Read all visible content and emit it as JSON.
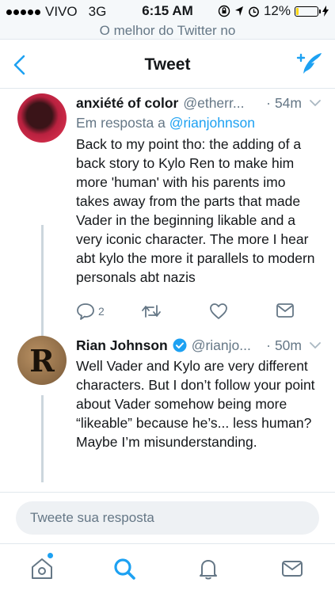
{
  "status": {
    "carrier": "VIVO",
    "network": "3G",
    "time": "6:15 AM",
    "battery": "12%",
    "battery_level": 0.12
  },
  "banner": "O melhor do Twitter no",
  "nav": {
    "title": "Tweet",
    "back_icon": "chevron-left-icon",
    "compose_icon": "compose-tweet-icon"
  },
  "tweets": [
    {
      "name": "anxiété of color",
      "handle": "@etherr...",
      "separator": "·",
      "time": "54m",
      "reply_prefix": "Em resposta a",
      "reply_to": "@rianjohnson",
      "text": "Back to my point tho: the adding of a back story to Kylo Ren to make him more 'human' with his parents imo takes away from the parts that made Vader in the beginning likable and a very iconic character. The more I hear abt kylo the more it parallels to modern personals abt nazis",
      "reply_count": "2"
    },
    {
      "name": "Rian Johnson",
      "handle": "@rianjo...",
      "separator": "·",
      "time": "50m",
      "avatar_letter": "R",
      "text": "Well Vader and Kylo are very different characters. But I don’t follow your point about Vader somehow being more “likeable” because he’s... less human? Maybe I’m misunderstanding."
    }
  ],
  "reply_bar": {
    "placeholder": "Tweete sua resposta"
  },
  "tabs": [
    "home-icon",
    "search-icon",
    "notifications-icon",
    "messages-icon"
  ],
  "colors": {
    "accent": "#1da1f2",
    "muted": "#657786",
    "border": "#e1e8ed"
  }
}
